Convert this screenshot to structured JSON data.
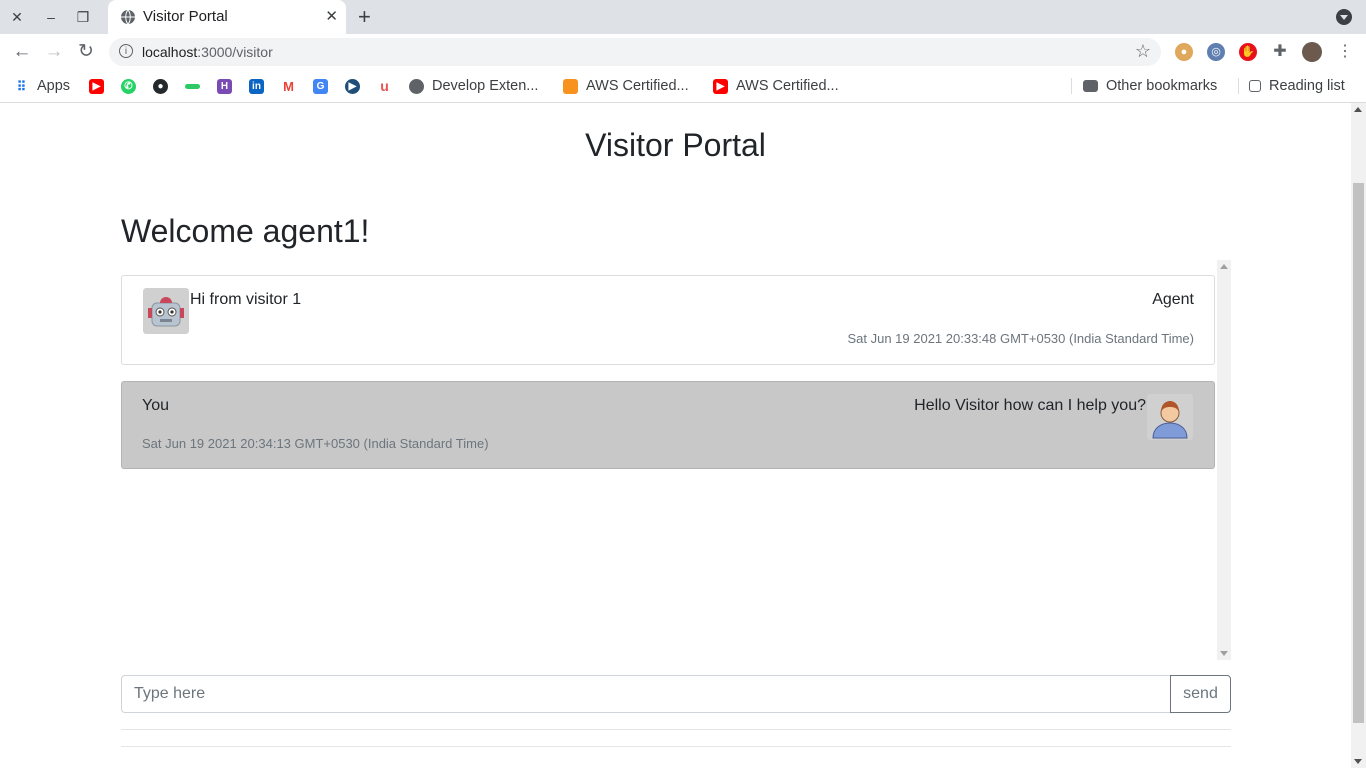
{
  "browser": {
    "tab_title": "Visitor Portal",
    "url_host": "localhost",
    "url_path": ":3000/visitor",
    "bookmarks": [
      {
        "label": "Apps"
      },
      {
        "label": "Develop Exten..."
      },
      {
        "label": "AWS Certified..."
      },
      {
        "label": "AWS Certified..."
      }
    ],
    "other_bookmarks": "Other bookmarks",
    "reading_list": "Reading list"
  },
  "page": {
    "title": "Visitor Portal",
    "welcome": "Welcome agent1!"
  },
  "messages": [
    {
      "text": "Hi from visitor 1",
      "sender": "Agent",
      "time": "Sat Jun 19 2021 20:33:48 GMT+0530 (India Standard Time)"
    },
    {
      "text": "Hello Visitor how can I help you?",
      "sender": "You",
      "time": "Sat Jun 19 2021 20:34:13 GMT+0530 (India Standard Time)"
    }
  ],
  "composer": {
    "placeholder": "Type here",
    "send_label": "send"
  }
}
